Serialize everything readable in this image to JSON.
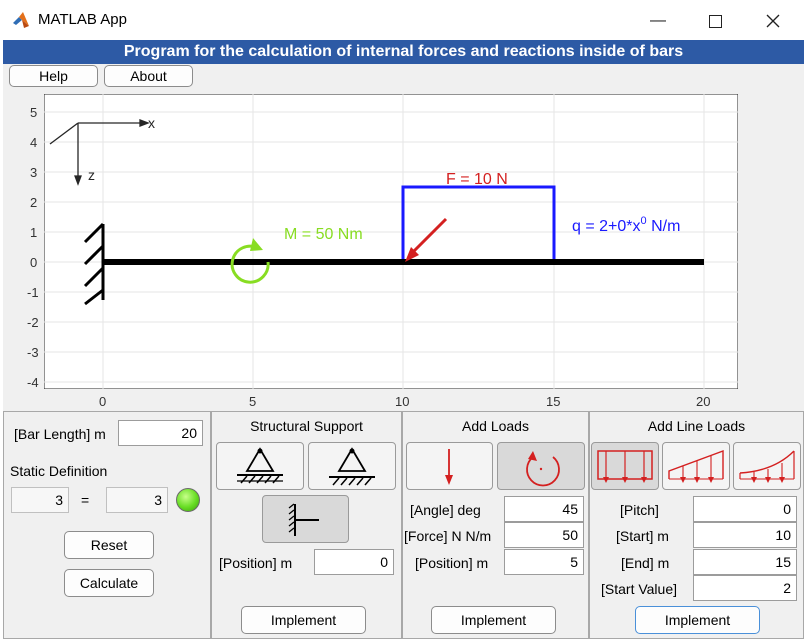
{
  "window": {
    "title": "MATLAB App"
  },
  "banner": {
    "text": "Program for the calculation of internal forces and reactions inside of bars"
  },
  "menu": {
    "help": "Help",
    "about": "About"
  },
  "plot": {
    "yticks": [
      "5",
      "4",
      "3",
      "2",
      "1",
      "0",
      "-1",
      "-2",
      "-3",
      "-4"
    ],
    "xticks": [
      "0",
      "5",
      "10",
      "15",
      "20"
    ],
    "axis_x_label": "x",
    "axis_z_label": "z",
    "moment_label": "M = 50 Nm",
    "force_label": "F = 10 N",
    "lineload_label_prefix": "q  =  2+0*x",
    "lineload_label_exp": "0",
    "lineload_label_unit": "  N/m",
    "colors": {
      "moment": "#88dd22",
      "force": "#d42020",
      "lineload": "#1a1aff",
      "beam": "#000000"
    }
  },
  "chart_data": {
    "type": "scatter",
    "xlim": [
      -2,
      21
    ],
    "ylim": [
      -4.2,
      5.2
    ],
    "y_reversed": false,
    "xticks": [
      0,
      5,
      10,
      15,
      20
    ],
    "yticks": [
      -4,
      -3,
      -2,
      -1,
      0,
      1,
      2,
      3,
      4,
      5
    ],
    "grid": true,
    "beam": {
      "x": [
        0,
        20
      ],
      "y": 0
    },
    "fixed_support_x": 0,
    "moment": {
      "x": 5,
      "value": 50
    },
    "force": {
      "x": 10,
      "angle_deg": 45,
      "value": 10
    },
    "line_load": {
      "start": 10,
      "end": 15,
      "height": 2.5
    }
  },
  "left_panel": {
    "bar_length_label": "[Bar Length] m",
    "bar_length_value": "20",
    "static_definition_label": "Static Definition",
    "static_left": "3",
    "equals": "=",
    "static_right": "3",
    "lamp_color": "#66dd22",
    "reset": "Reset",
    "calculate": "Calculate"
  },
  "support_panel": {
    "title": "Structural Support",
    "position_label": "[Position] m",
    "position_value": "0",
    "implement": "Implement"
  },
  "loads_panel": {
    "title": "Add Loads",
    "angle_label": "[Angle] deg",
    "angle_value": "45",
    "force_label": "[Force] N N/m",
    "force_value": "50",
    "position_label": "[Position] m",
    "position_value": "5",
    "implement": "Implement"
  },
  "line_loads_panel": {
    "title": "Add Line Loads",
    "pitch_label": "[Pitch]",
    "pitch_value": "0",
    "start_label": "[Start] m",
    "start_value": "10",
    "end_label": "[End] m",
    "end_value": "15",
    "start_value_label": "[Start Value]",
    "start_value_value": "2",
    "implement": "Implement"
  }
}
